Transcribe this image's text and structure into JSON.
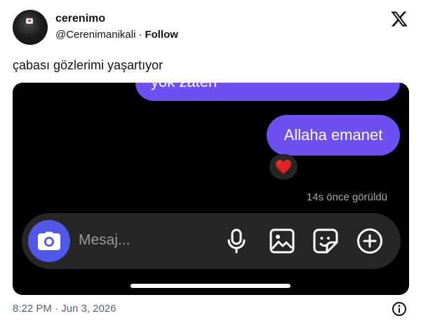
{
  "tweet": {
    "author_name": "cerenimo",
    "handle": "@Cerenimanikali",
    "separator": "·",
    "follow_label": "Follow",
    "text": "çabası gözlerimi yaşartıyor",
    "timestamp": "8:22 PM · Jun 3, 2026",
    "logo": "x-logo-icon",
    "info_icon": "info-icon"
  },
  "chat": {
    "partial_message": "yok zaten",
    "message": "Allaha emanet",
    "reaction": "❤️",
    "seen_status": "14s önce görüldü",
    "input_placeholder": "Mesaj...",
    "bubble_color": "#6e4ff0",
    "camera_color": "#4f58e8",
    "icons": [
      "camera-icon",
      "microphone-icon",
      "gallery-icon",
      "sticker-icon",
      "add-icon"
    ]
  }
}
